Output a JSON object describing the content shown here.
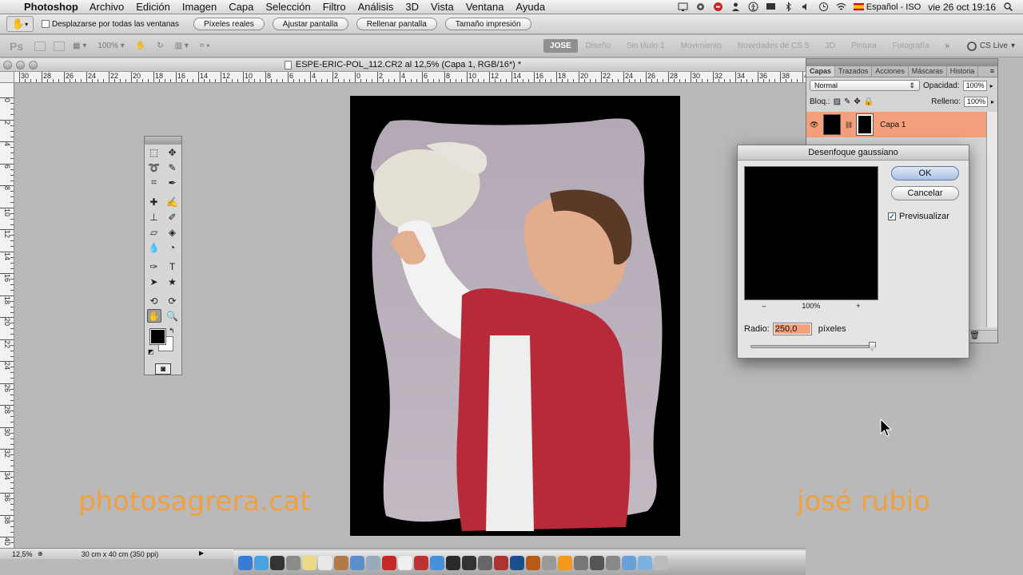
{
  "menubar": {
    "app_name": "Photoshop",
    "items": [
      "Archivo",
      "Edición",
      "Imagen",
      "Capa",
      "Selección",
      "Filtro",
      "Análisis",
      "3D",
      "Vista",
      "Ventana",
      "Ayuda"
    ],
    "input_language": "Español - ISO",
    "datetime": "vie 26 oct  19:16"
  },
  "options_bar": {
    "scroll_all_label": "Desplazarse por todas las ventanas",
    "buttons": [
      "Píxeles reales",
      "Ajustar pantalla",
      "Rellenar pantalla",
      "Tamaño impresión"
    ]
  },
  "app_bar": {
    "logo": "Ps",
    "zoom_value": "100%",
    "workspaces": [
      "JOSE",
      "Diseño",
      "Sin título-1",
      "Movimiento",
      "Novedades de CS 5",
      "3D",
      "Pintura",
      "Fotografía"
    ],
    "active_workspace": "JOSE",
    "cs_live": "CS Live"
  },
  "document": {
    "title": "ESPE-ERIC-POL_112.CR2 al 12,5% (Capa 1, RGB/16*) *",
    "zoom": "12,5%",
    "doc_info": "30 cm x 40 cm (350 ppi)",
    "ruler_h": [
      "30",
      "28",
      "26",
      "24",
      "22",
      "20",
      "18",
      "16",
      "14",
      "12",
      "10",
      "8",
      "6",
      "4",
      "2",
      "0",
      "2",
      "4",
      "6",
      "8",
      "10",
      "12",
      "14",
      "16",
      "18",
      "20",
      "22",
      "24",
      "26",
      "28",
      "30",
      "32",
      "34",
      "36",
      "38",
      "40"
    ],
    "ruler_v": [
      "0",
      "2",
      "4",
      "6",
      "8",
      "10",
      "12",
      "14",
      "16",
      "18",
      "20",
      "22",
      "24",
      "26",
      "28",
      "30",
      "32",
      "34",
      "36",
      "38",
      "40"
    ]
  },
  "watermarks": {
    "left": "photosagrera.cat",
    "right": "josé rubio"
  },
  "layers_panel": {
    "tabs": [
      "Capas",
      "Trazados",
      "Acciones",
      "Máscaras",
      "Historia"
    ],
    "active_tab": "Capas",
    "blend_mode": "Normal",
    "opacity_label": "Opacidad:",
    "opacity_value": "100%",
    "lock_label": "Bloq.:",
    "fill_label": "Relleno:",
    "fill_value": "100%",
    "layer_name": "Capa 1"
  },
  "gaussian_dialog": {
    "title": "Desenfoque gaussiano",
    "ok_label": "OK",
    "cancel_label": "Cancelar",
    "preview_label": "Previsualizar",
    "preview_checked": true,
    "zoom_minus": "–",
    "zoom_value": "100%",
    "zoom_plus": "+",
    "radius_label": "Radio:",
    "radius_value": "250,0",
    "radius_unit": "píxeles",
    "slider_fraction": 0.98
  },
  "colors": {
    "accent_layer": "#f4a07c",
    "watermark": "#f0a040",
    "foreground": "#000000",
    "background": "#ffffff"
  }
}
